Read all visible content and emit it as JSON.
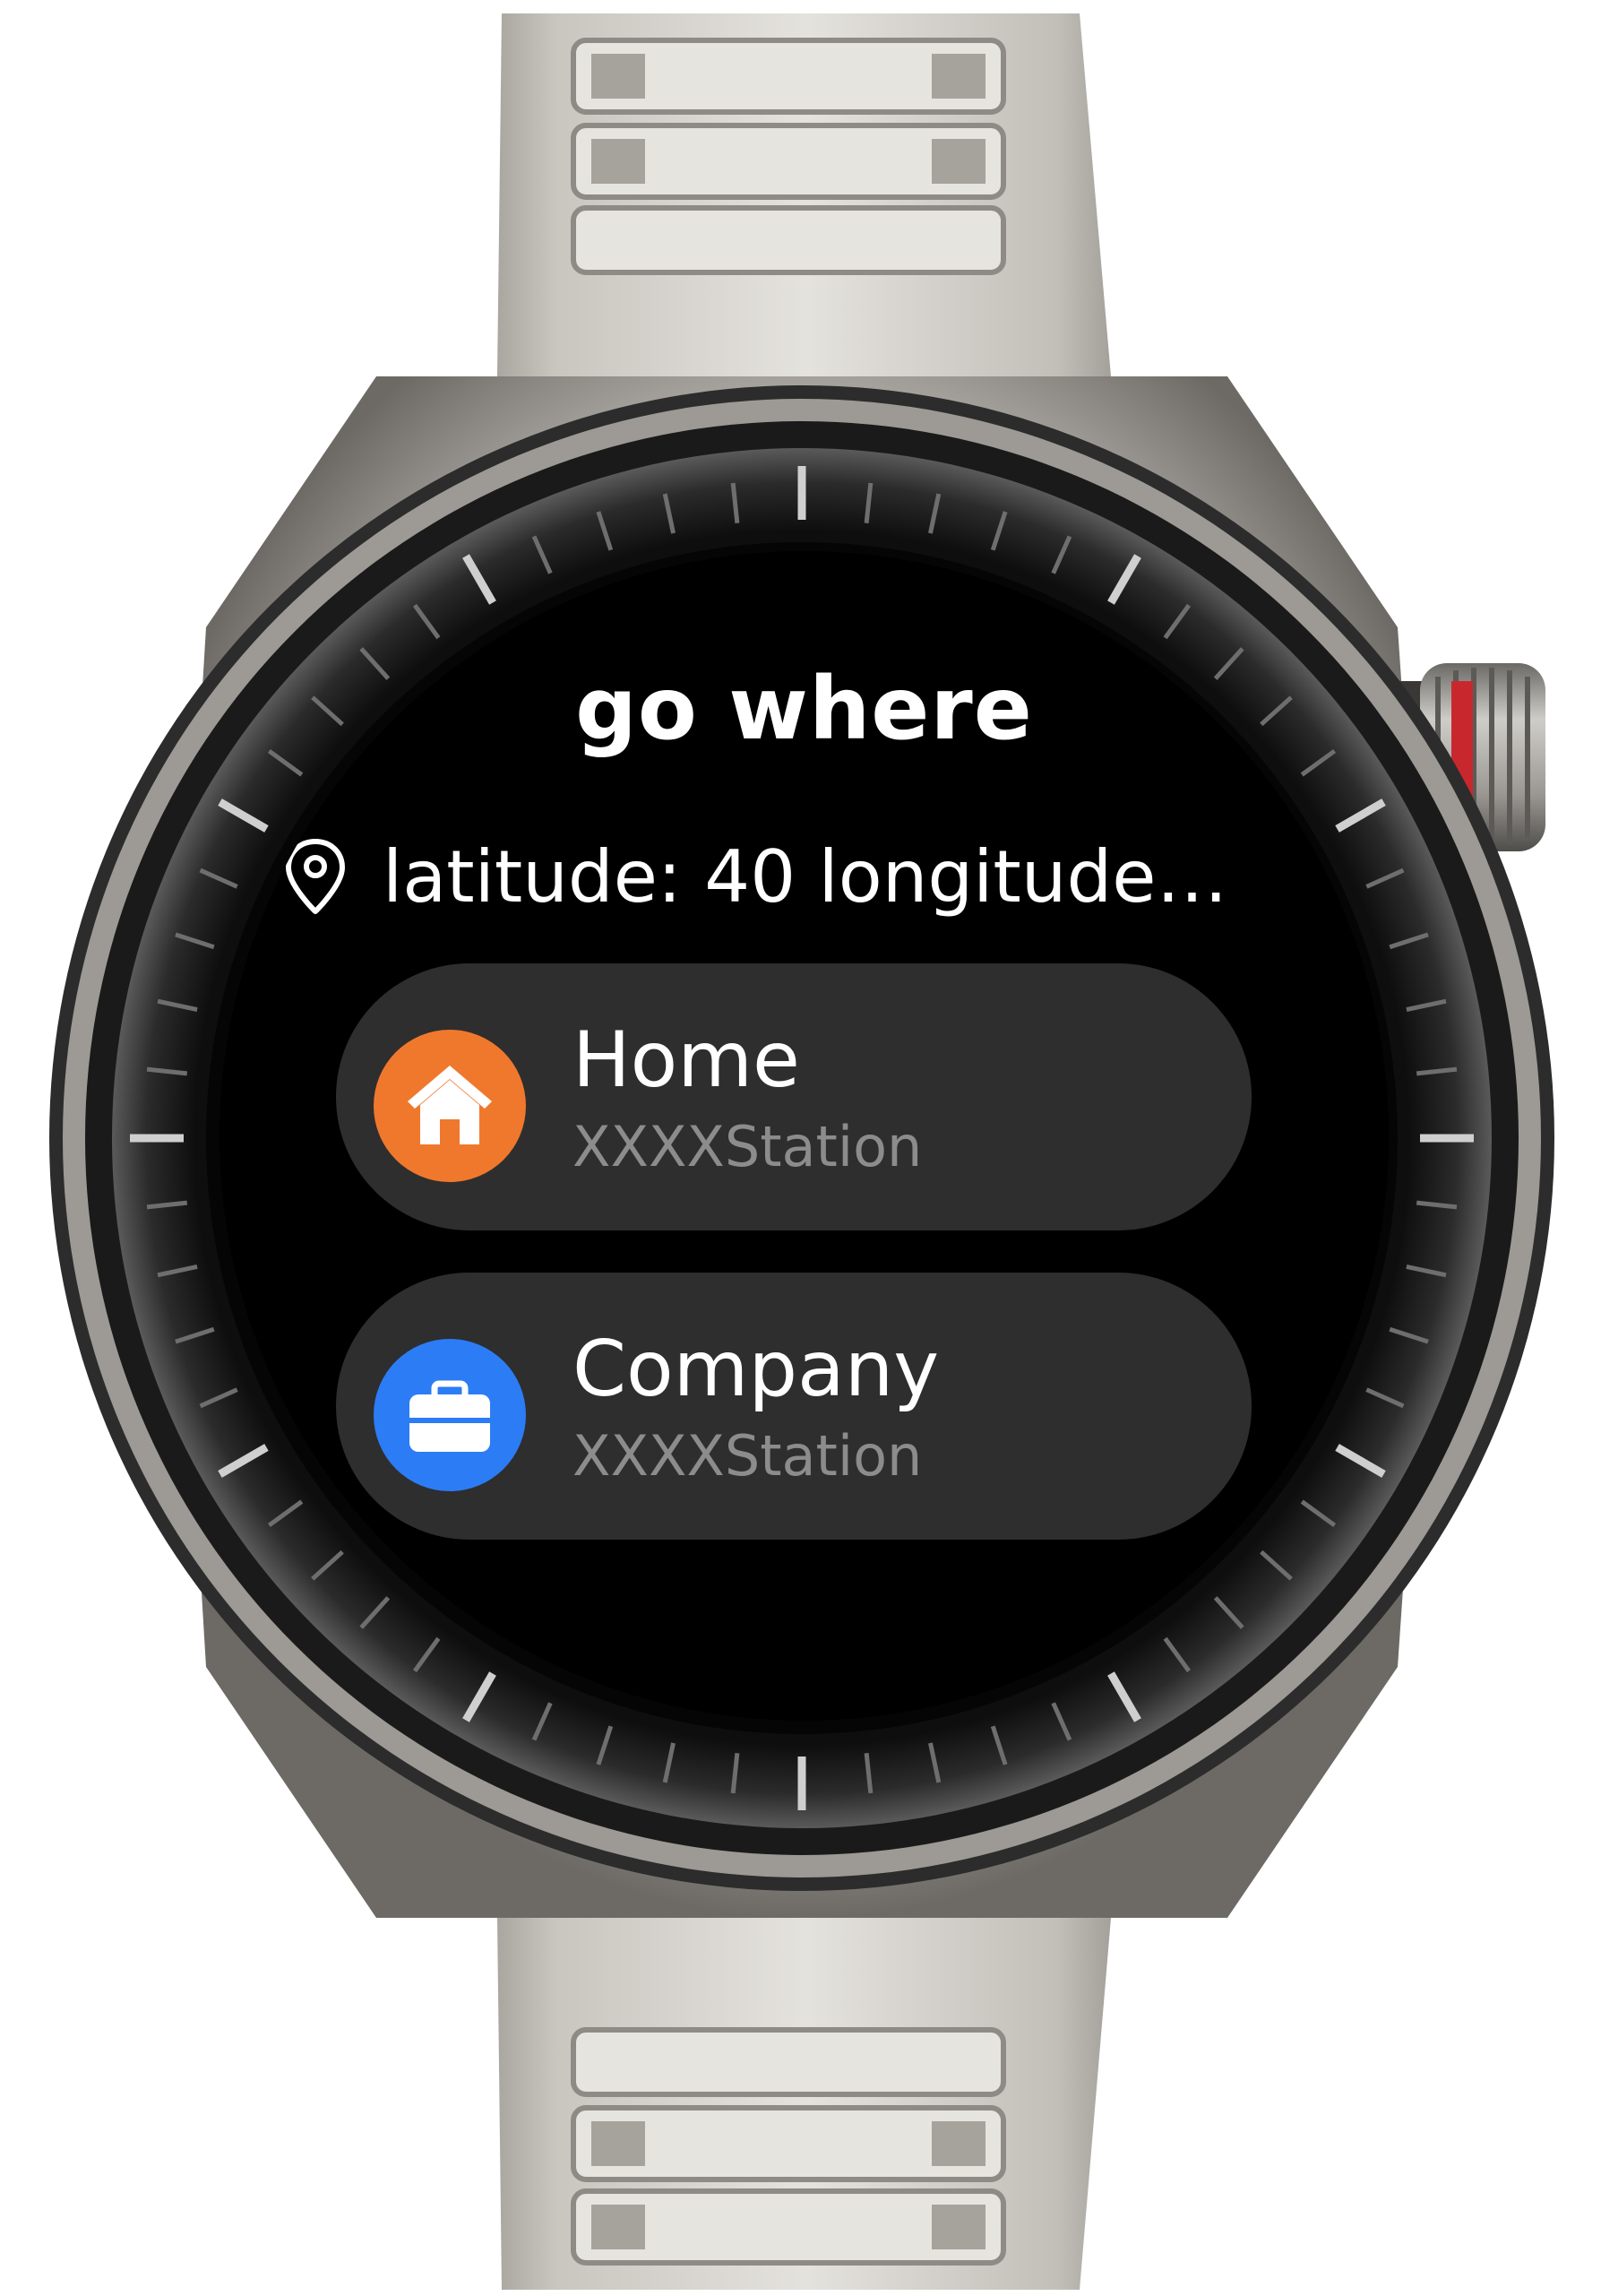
{
  "screen": {
    "title": "go where",
    "location": {
      "icon": "location-pin-icon",
      "text": "latitude:  40  longitude…"
    },
    "places": [
      {
        "name": "Home",
        "station": "XXXXStation",
        "icon": "home-icon",
        "icon_color": "#F0782D"
      },
      {
        "name": "Company",
        "station": "XXXXStation",
        "icon": "briefcase-icon",
        "icon_color": "#2C7CF6"
      }
    ]
  },
  "colors": {
    "screen_background": "#000000",
    "card_background": "#2E2E2E",
    "primary_text": "#FFFFFF",
    "secondary_text": "#8C8C8C",
    "crown_accent": "#C8282D"
  }
}
